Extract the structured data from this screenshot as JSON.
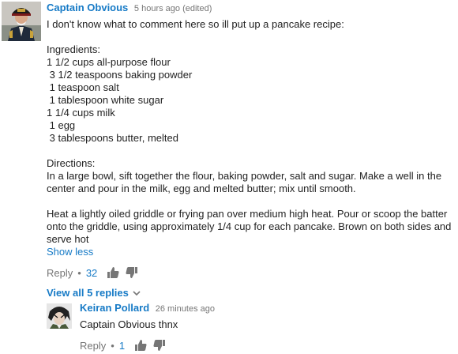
{
  "comment": {
    "author": "Captain Obvious",
    "time": "5 hours ago (edited)",
    "text": "I don't know what to comment here so ill put up a pancake recipe:\n\nIngredients:\n1 1/2 cups all-purpose flour\n 3 1/2 teaspoons baking powder\n 1 teaspoon salt\n 1 tablespoon white sugar\n1 1/4 cups milk\n 1 egg\n 3 tablespoons butter, melted\n\nDirections:\nIn a large bowl, sift together the flour, baking powder, salt and sugar. Make a well in the center and pour in the milk, egg and melted butter; mix until smooth.\n\nHeat a lightly oiled griddle or frying pan over medium high heat. Pour or scoop the batter onto the griddle, using approximately 1/4 cup for each pancake. Brown on both sides and serve hot",
    "show_less": "Show less",
    "reply_label": "Reply",
    "separator": "•",
    "like_count": "32",
    "like_icon": "thumbs-up-icon",
    "dislike_icon": "thumbs-down-icon",
    "avatar_icon": "avatar"
  },
  "view_replies": "View all 5 replies",
  "reply": {
    "author": "Keiran Pollard",
    "time": "26 minutes ago",
    "text": "Captain Obvious thnx",
    "reply_label": "Reply",
    "separator": "•",
    "like_count": "1",
    "like_icon": "thumbs-up-icon",
    "dislike_icon": "thumbs-down-icon",
    "avatar_icon": "avatar"
  },
  "colors": {
    "link_blue": "#167ac6",
    "meta_gray": "#767676",
    "text": "#222222"
  }
}
